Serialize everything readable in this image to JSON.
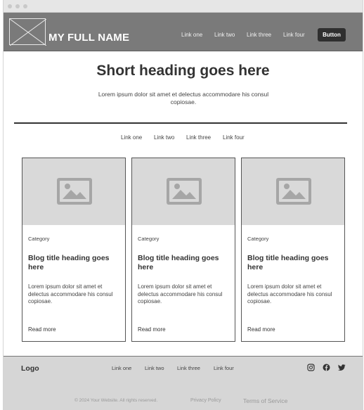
{
  "header": {
    "site_name": "MY FULL NAME",
    "nav": [
      "Link one",
      "Link two",
      "Link three",
      "Link four"
    ],
    "button_label": "Button"
  },
  "hero": {
    "title": "Short heading goes here",
    "text": "Lorem ipsum dolor sit amet et delectus accommodare his consul copiosae."
  },
  "section_nav": [
    "Link one",
    "Link two",
    "Link three",
    "Link four"
  ],
  "cards": [
    {
      "category": "Category",
      "title": "Blog title heading goes here",
      "body": "Lorem ipsum dolor sit amet et delectus accommodare his consul copiosae.",
      "link": "Read more"
    },
    {
      "category": "Category",
      "title": "Blog title heading goes here",
      "body": "Lorem ipsum dolor sit amet et delectus accommodare his consul copiosae.",
      "link": "Read more"
    },
    {
      "category": "Category",
      "title": "Blog title heading goes here",
      "body": "Lorem ipsum dolor sit amet et delectus accommodare his consul copiosae.",
      "link": "Read more"
    }
  ],
  "footer": {
    "logo": "Logo",
    "nav": [
      "Link one",
      "Link two",
      "Link three",
      "Link four"
    ],
    "social_icons": [
      "instagram-icon",
      "facebook-icon",
      "twitter-icon"
    ],
    "copyright": "© 2024 Your Website. All rights reserved.",
    "privacy": "Privacy Policy",
    "terms": "Terms of Service"
  },
  "colors": {
    "header_bg": "#7a7a7a",
    "button_bg": "#2f2f2f",
    "placeholder_bg": "#d9d9d9",
    "footer_bg": "#d6d6d6"
  }
}
